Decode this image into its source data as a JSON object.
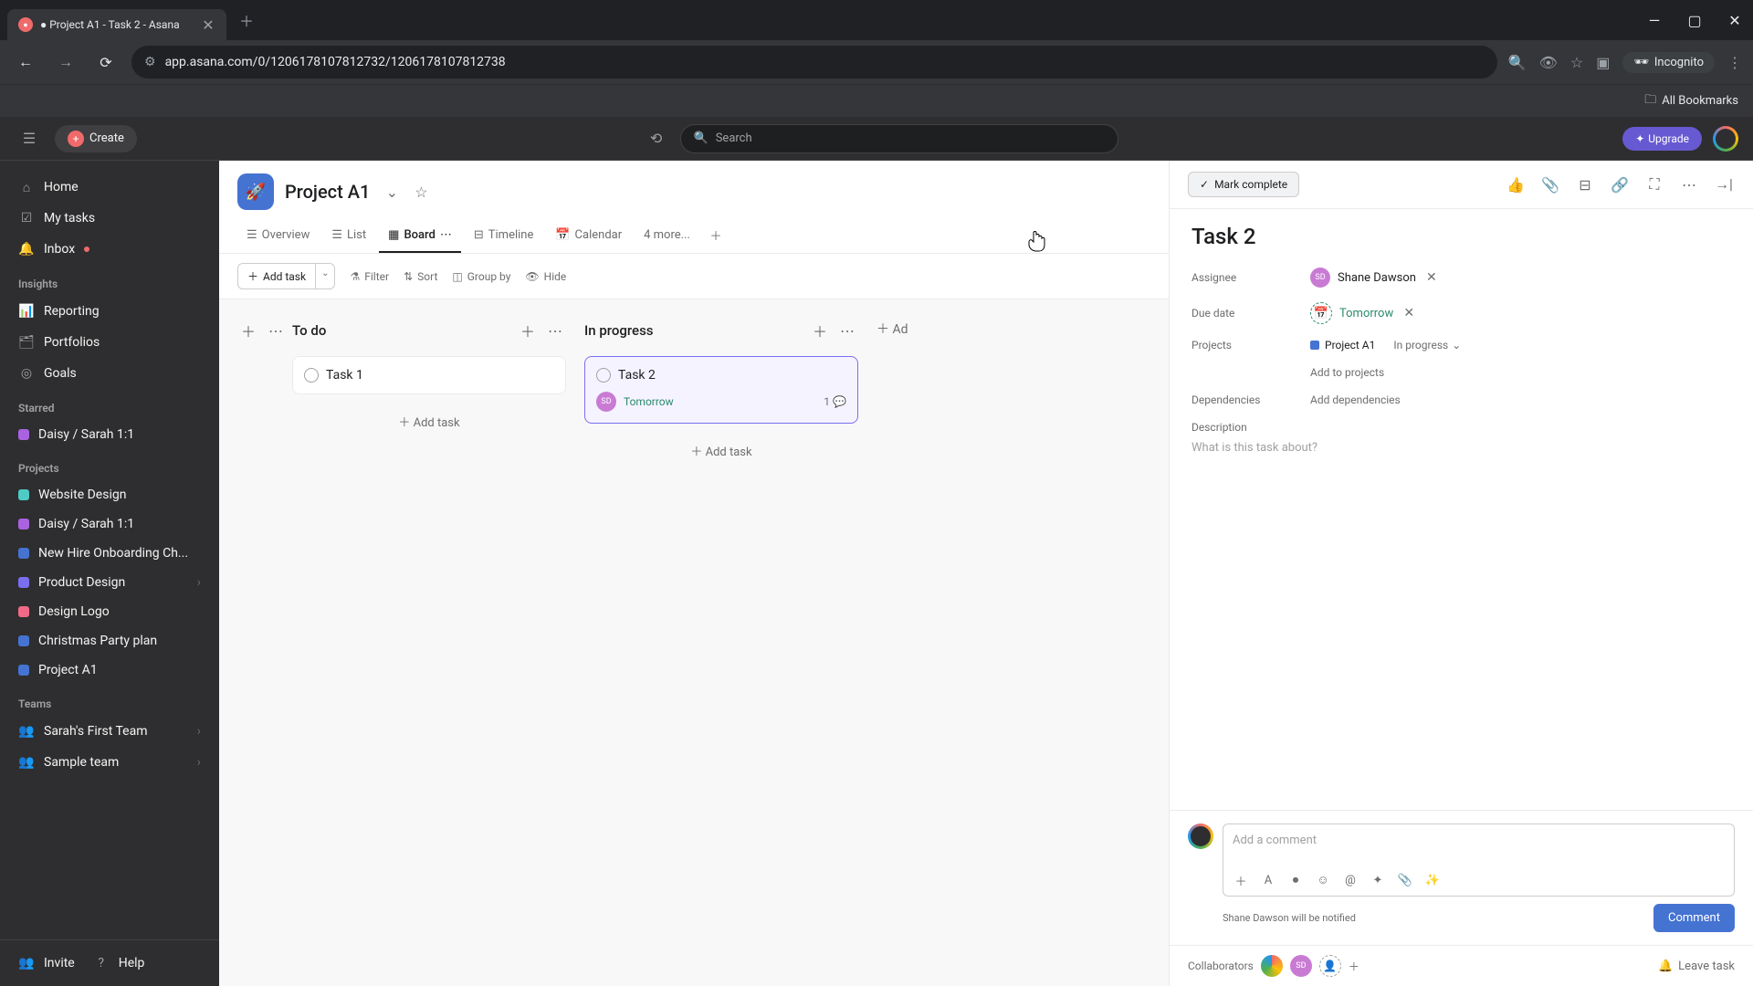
{
  "browser": {
    "tab_title": "● Project A1 - Task 2 - Asana",
    "url": "app.asana.com/0/1206178107812732/1206178107812738",
    "incognito": "Incognito",
    "bookmarks": "All Bookmarks"
  },
  "topbar": {
    "create": "Create",
    "search_placeholder": "Search",
    "upgrade": "Upgrade"
  },
  "sidebar": {
    "home": "Home",
    "my_tasks": "My tasks",
    "inbox": "Inbox",
    "insights": "Insights",
    "reporting": "Reporting",
    "portfolios": "Portfolios",
    "goals": "Goals",
    "starred": "Starred",
    "starred_items": [
      "Daisy / Sarah 1:1"
    ],
    "projects_label": "Projects",
    "projects": [
      {
        "name": "Website Design",
        "color": "proj-teal"
      },
      {
        "name": "Daisy / Sarah 1:1",
        "color": "proj-purple"
      },
      {
        "name": "New Hire Onboarding Ch...",
        "color": "proj-blue"
      },
      {
        "name": "Product Design",
        "color": "proj-purple2",
        "expandable": true
      },
      {
        "name": "Design Logo",
        "color": "proj-pink"
      },
      {
        "name": "Christmas Party plan",
        "color": "proj-blue2"
      },
      {
        "name": "Project A1",
        "color": "proj-blue3"
      }
    ],
    "teams_label": "Teams",
    "teams": [
      {
        "name": "Sarah's First Team",
        "expandable": true
      },
      {
        "name": "Sample team",
        "expandable": true
      }
    ],
    "invite": "Invite",
    "help": "Help"
  },
  "project": {
    "name": "Project A1",
    "tabs": {
      "overview": "Overview",
      "list": "List",
      "board": "Board",
      "timeline": "Timeline",
      "calendar": "Calendar",
      "more": "4 more..."
    },
    "toolbar": {
      "add_task": "Add task",
      "filter": "Filter",
      "sort": "Sort",
      "group_by": "Group by",
      "hide": "Hide"
    }
  },
  "board": {
    "columns": [
      {
        "title": "To do",
        "cards": [
          {
            "title": "Task 1"
          }
        ],
        "add": "Add task"
      },
      {
        "title": "In progress",
        "cards": [
          {
            "title": "Task 2",
            "due": "Tomorrow",
            "assignee": "SD",
            "comments": "1",
            "selected": true
          }
        ],
        "add": "Add task"
      }
    ],
    "add_section_prefix": "Ad"
  },
  "task": {
    "mark_complete": "Mark complete",
    "title": "Task 2",
    "fields": {
      "assignee_label": "Assignee",
      "assignee_name": "Shane Dawson",
      "assignee_initials": "SD",
      "due_label": "Due date",
      "due_value": "Tomorrow",
      "projects_label": "Projects",
      "project_name": "Project A1",
      "project_status": "In progress",
      "add_projects": "Add to projects",
      "dependencies_label": "Dependencies",
      "add_dependencies": "Add dependencies",
      "description_label": "Description",
      "description_placeholder": "What is this task about?"
    },
    "comment": {
      "placeholder": "Add a comment",
      "notify": "Shane Dawson will be notified",
      "button": "Comment"
    },
    "footer": {
      "collaborators": "Collaborators",
      "leave": "Leave task"
    }
  }
}
